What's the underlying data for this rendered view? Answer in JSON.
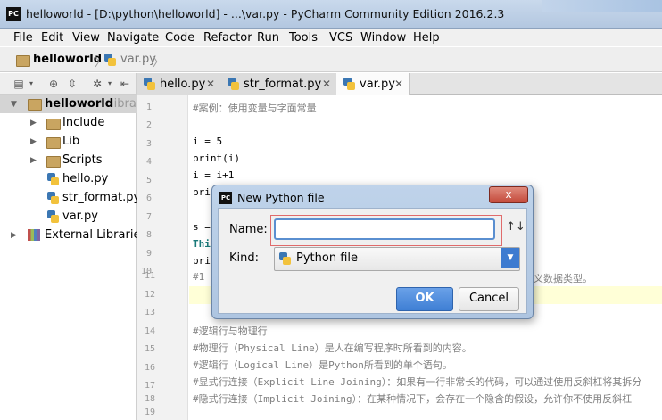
{
  "window": {
    "title": "helloworld - [D:\\python\\helloworld] - ...\\var.py - PyCharm Community Edition 2016.2.3",
    "app_icon_text": "PC"
  },
  "menu": [
    "File",
    "Edit",
    "View",
    "Navigate",
    "Code",
    "Refactor",
    "Run",
    "Tools",
    "VCS",
    "Window",
    "Help"
  ],
  "breadcrumb": [
    "helloworld",
    "var.py"
  ],
  "tabs": [
    {
      "label": "hello.py",
      "active": false
    },
    {
      "label": "str_format.py",
      "active": false
    },
    {
      "label": "var.py",
      "active": true
    }
  ],
  "project_tree": {
    "root": "helloworld",
    "root_suffix": "librar",
    "items": [
      "Include",
      "Lib",
      "Scripts",
      "hello.py",
      "str_format.py",
      "var.py"
    ],
    "external": "External Libraries"
  },
  "editor": {
    "line_numbers": [
      "1",
      "2",
      "3",
      "4",
      "5",
      "6",
      "7",
      "8",
      "9",
      "10",
      "11",
      "12",
      "13",
      "14",
      "15",
      "16",
      "17",
      "18",
      "19"
    ],
    "lines": [
      "#案例：使用变量与字面常量",
      "",
      "i = 5",
      "print(i)",
      "i = i+1",
      "prin",
      "",
      "s =",
      "This",
      "prin",
      "#1",
      "",
      "",
      "#逻辑行与物理行",
      "#物理行（Physical Line）是人在编写程序时所看到的内容。",
      "#逻辑行（Logical Line）是Python所看到的单个语句。",
      "#显式行连接（Explicit Line Joining）：如果有一行非常长的代码，可以通过使用反斜杠将其拆分",
      "#隐式行连接（Implicit Joining）：在某种情况下，会存在一个隐含的假设，允许你不使用反斜杠",
      ""
    ],
    "line11_tail": "义数据类型。"
  },
  "dialog": {
    "title": "New Python file",
    "icon_text": "PC",
    "name_label": "Name:",
    "name_value": "",
    "kind_label": "Kind:",
    "kind_value": "Python file",
    "ok_label": "OK",
    "cancel_label": "Cancel",
    "close_glyph": "x",
    "sort_glyph": "↑↓"
  },
  "colors": {
    "accent": "#3f7fd4",
    "focus_border": "#e06b6b",
    "current_line": "#ffffd7"
  }
}
